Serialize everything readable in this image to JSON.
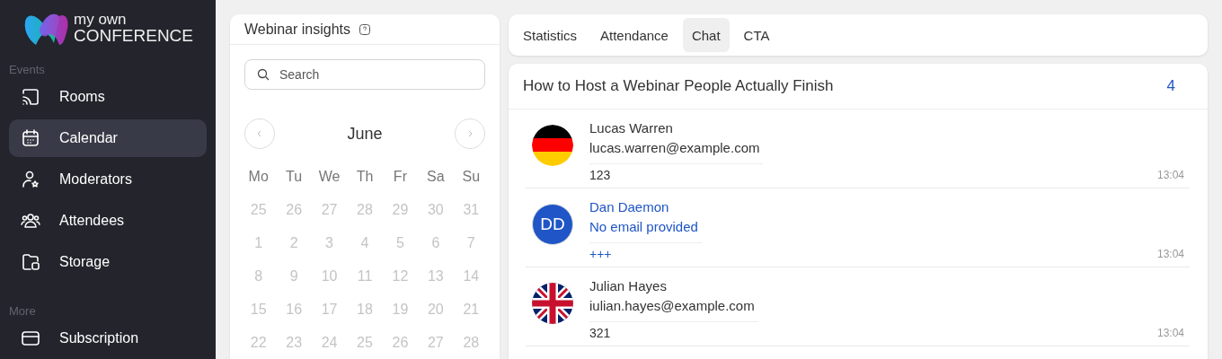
{
  "logo": {
    "line_1": "my own",
    "line_2": "CONFERENCE"
  },
  "sidebar": {
    "sections": [
      {
        "title": "Events",
        "items": [
          {
            "label": "Rooms",
            "kind": "cast",
            "selected": false
          },
          {
            "label": "Calendar",
            "kind": "calendar",
            "selected": true
          },
          {
            "label": "Moderators",
            "kind": "moderator",
            "selected": false
          },
          {
            "label": "Attendees",
            "kind": "people",
            "selected": false
          },
          {
            "label": "Storage",
            "kind": "folder",
            "selected": false
          }
        ]
      },
      {
        "title": "More",
        "items": [
          {
            "label": "Subscription",
            "kind": "card",
            "selected": false
          }
        ]
      }
    ]
  },
  "insights": {
    "title": "Webinar insights",
    "search": {
      "placeholder": "Search"
    },
    "calendar": {
      "month": "June",
      "weekdays": [
        "Mo",
        "Tu",
        "We",
        "Th",
        "Fr",
        "Sa",
        "Su"
      ],
      "weeks": [
        [
          {
            "label": "25",
            "disabled": true
          },
          {
            "label": "26",
            "disabled": true
          },
          {
            "label": "27",
            "disabled": true
          },
          {
            "label": "28",
            "disabled": true
          },
          {
            "label": "29",
            "disabled": true
          },
          {
            "label": "30",
            "disabled": true
          },
          {
            "label": "31",
            "disabled": true
          }
        ],
        [
          {
            "label": "1",
            "disabled": true
          },
          {
            "label": "2",
            "disabled": true
          },
          {
            "label": "3",
            "disabled": true
          },
          {
            "label": "4",
            "disabled": true
          },
          {
            "label": "5",
            "disabled": true
          },
          {
            "label": "6",
            "disabled": true
          },
          {
            "label": "7",
            "disabled": true
          }
        ],
        [
          {
            "label": "8",
            "disabled": true
          },
          {
            "label": "9",
            "disabled": true
          },
          {
            "label": "10",
            "disabled": true
          },
          {
            "label": "11",
            "disabled": true
          },
          {
            "label": "12",
            "disabled": true
          },
          {
            "label": "13",
            "disabled": true
          },
          {
            "label": "14",
            "disabled": true
          }
        ],
        [
          {
            "label": "15",
            "disabled": true
          },
          {
            "label": "16",
            "disabled": true
          },
          {
            "label": "17",
            "disabled": true
          },
          {
            "label": "18",
            "disabled": true
          },
          {
            "label": "19",
            "disabled": true
          },
          {
            "label": "20",
            "disabled": true
          },
          {
            "label": "21",
            "disabled": true
          }
        ],
        [
          {
            "label": "22",
            "disabled": true
          },
          {
            "label": "23",
            "disabled": true
          },
          {
            "label": "24",
            "disabled": true
          },
          {
            "label": "25",
            "disabled": true
          },
          {
            "label": "26",
            "disabled": true
          },
          {
            "label": "27",
            "disabled": true
          },
          {
            "label": "28",
            "disabled": true
          }
        ]
      ]
    }
  },
  "tabs": [
    {
      "label": "Statistics",
      "selected": false
    },
    {
      "label": "Attendance",
      "selected": false
    },
    {
      "label": "Chat",
      "selected": true
    },
    {
      "label": "CTA",
      "selected": false
    }
  ],
  "chat": {
    "title": "How to Host a Webinar People Actually Finish",
    "count": "4",
    "messages": [
      {
        "kind": "flag-de",
        "name": "Lucas Warren",
        "email": "lucas.warren@example.com",
        "text": "123",
        "time": "13:04",
        "highlighted": false
      },
      {
        "kind": "initials",
        "initials": "DD",
        "name": "Dan Daemon",
        "email": "No email provided",
        "text": "+++",
        "time": "13:04",
        "highlighted": true
      },
      {
        "kind": "flag-uk",
        "name": "Julian Hayes",
        "email": "iulian.hayes@example.com",
        "text": "321",
        "time": "13:04",
        "highlighted": false
      }
    ]
  }
}
